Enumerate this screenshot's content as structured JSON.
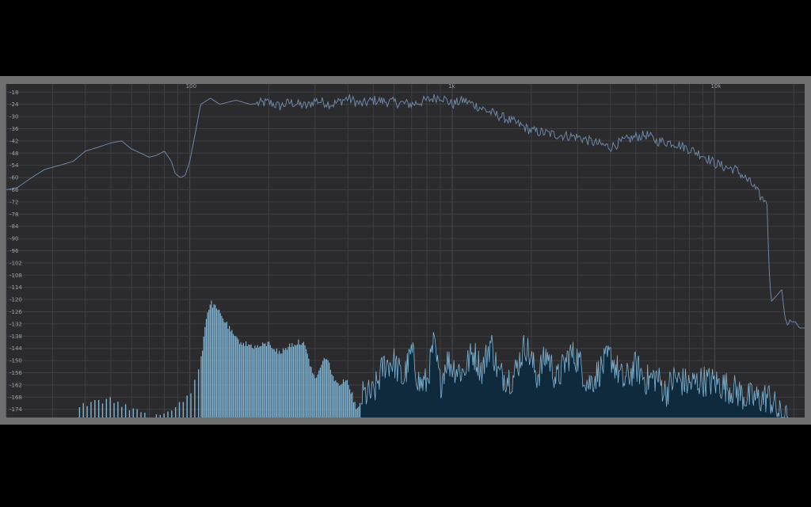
{
  "chart_data": {
    "type": "area",
    "title": "",
    "xlabel": "",
    "ylabel": "",
    "x_scale": "log",
    "xlim": [
      20,
      22000
    ],
    "ylim": [
      -178,
      -14
    ],
    "grid": true,
    "x_tick_labels": [
      {
        "value": 100,
        "label": "100"
      },
      {
        "value": 1000,
        "label": "1k"
      },
      {
        "value": 10000,
        "label": "10k"
      }
    ],
    "y_ticks": [
      -18,
      -24,
      -30,
      -36,
      -42,
      -48,
      -54,
      -60,
      -66,
      -72,
      -78,
      -84,
      -90,
      -96,
      -102,
      -108,
      -114,
      -120,
      -126,
      -132,
      -138,
      -144,
      -150,
      -156,
      -162,
      -168,
      -174
    ],
    "colors": {
      "plot_background": "#2b2b2e",
      "frame": "#6f6f6f",
      "max_line": "#6d86a6",
      "spectrum_bars": "#7fb4d4",
      "spectrum_fill": "#0f2a3d",
      "spectrum_edge": "#7fb4d4"
    },
    "series": [
      {
        "role": "max-hold-line",
        "x": [
          20,
          22,
          25,
          28,
          32,
          36,
          40,
          45,
          50,
          55,
          60,
          65,
          70,
          75,
          80,
          85,
          88,
          92,
          96,
          100,
          105,
          110,
          120,
          130,
          150,
          170,
          200,
          220,
          240,
          260,
          280,
          300,
          350,
          400,
          450,
          500,
          600,
          700,
          800,
          900,
          1000,
          1100,
          1200,
          1400,
          1600,
          1800,
          2000,
          2500,
          3000,
          3500,
          4000,
          4500,
          5000,
          5500,
          6000,
          7000,
          8000,
          9000,
          10000,
          11000,
          12000,
          13000,
          14000,
          15000,
          15800,
          16100,
          16400,
          17500,
          18000,
          18500,
          19000,
          19300,
          19600,
          20300,
          21000,
          22000
        ],
        "y": [
          -66,
          -65,
          -60,
          -56,
          -54,
          -52,
          -47,
          -45,
          -43,
          -42,
          -46,
          -48,
          -50,
          -49,
          -47,
          -52,
          -58,
          -60,
          -59,
          -52,
          -38,
          -24,
          -21,
          -24,
          -22,
          -24,
          -23,
          -25,
          -23,
          -24,
          -25,
          -22,
          -24,
          -21,
          -24,
          -22,
          -23,
          -24,
          -22,
          -20,
          -24,
          -22,
          -24,
          -28,
          -31,
          -34,
          -37,
          -39,
          -40,
          -43,
          -45,
          -42,
          -40,
          -39,
          -42,
          -43,
          -46,
          -49,
          -53,
          -55,
          -56,
          -60,
          -64,
          -70,
          -72,
          -105,
          -121,
          -117,
          -115,
          -129,
          -133,
          -130,
          -131,
          -131,
          -134,
          -134
        ]
      },
      {
        "role": "current-spectrum",
        "x": [
          20,
          25,
          30,
          35,
          40,
          50,
          60,
          70,
          80,
          90,
          100,
          110,
          115,
          120,
          130,
          140,
          150,
          160,
          180,
          200,
          220,
          240,
          270,
          300,
          330,
          360,
          400,
          430,
          460,
          500,
          550,
          600,
          650,
          700,
          750,
          800,
          850,
          900,
          950,
          1000,
          1100,
          1200,
          1300,
          1400,
          1500,
          1700,
          1900,
          2100,
          2300,
          2500,
          2800,
          3000,
          3300,
          3600,
          4000,
          4500,
          5000,
          5500,
          6000,
          6500,
          7000,
          8000,
          9000,
          10000,
          11000,
          12000,
          13000,
          14000,
          15000,
          16000,
          17000,
          18000,
          18500,
          19000,
          20000,
          22000
        ],
        "y": [
          -178,
          -178,
          -178,
          -174,
          -170,
          -168,
          -172,
          -176,
          -174,
          -170,
          -166,
          -150,
          -128,
          -120,
          -125,
          -132,
          -138,
          -140,
          -142,
          -140,
          -145,
          -141,
          -139,
          -158,
          -146,
          -160,
          -158,
          -172,
          -166,
          -166,
          -151,
          -150,
          -159,
          -145,
          -161,
          -160,
          -141,
          -161,
          -149,
          -152,
          -155,
          -145,
          -154,
          -140,
          -156,
          -158,
          -141,
          -157,
          -146,
          -159,
          -146,
          -148,
          -161,
          -155,
          -147,
          -160,
          -152,
          -159,
          -157,
          -165,
          -158,
          -161,
          -159,
          -160,
          -162,
          -164,
          -167,
          -168,
          -168,
          -167,
          -172,
          -178,
          -178,
          -178,
          -178,
          -178
        ]
      }
    ]
  }
}
